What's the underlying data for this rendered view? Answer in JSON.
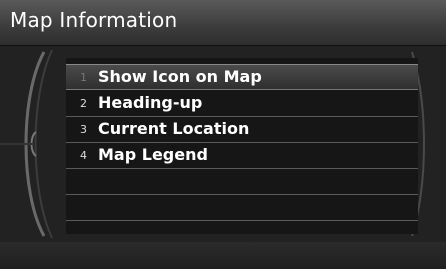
{
  "header": {
    "title": "Map Information"
  },
  "menu": {
    "items": [
      {
        "number": "1",
        "label": "Show Icon on Map",
        "selected": true
      },
      {
        "number": "2",
        "label": "Heading-up",
        "selected": false
      },
      {
        "number": "3",
        "label": "Current Location",
        "selected": false
      },
      {
        "number": "4",
        "label": "Map Legend",
        "selected": false
      }
    ]
  }
}
